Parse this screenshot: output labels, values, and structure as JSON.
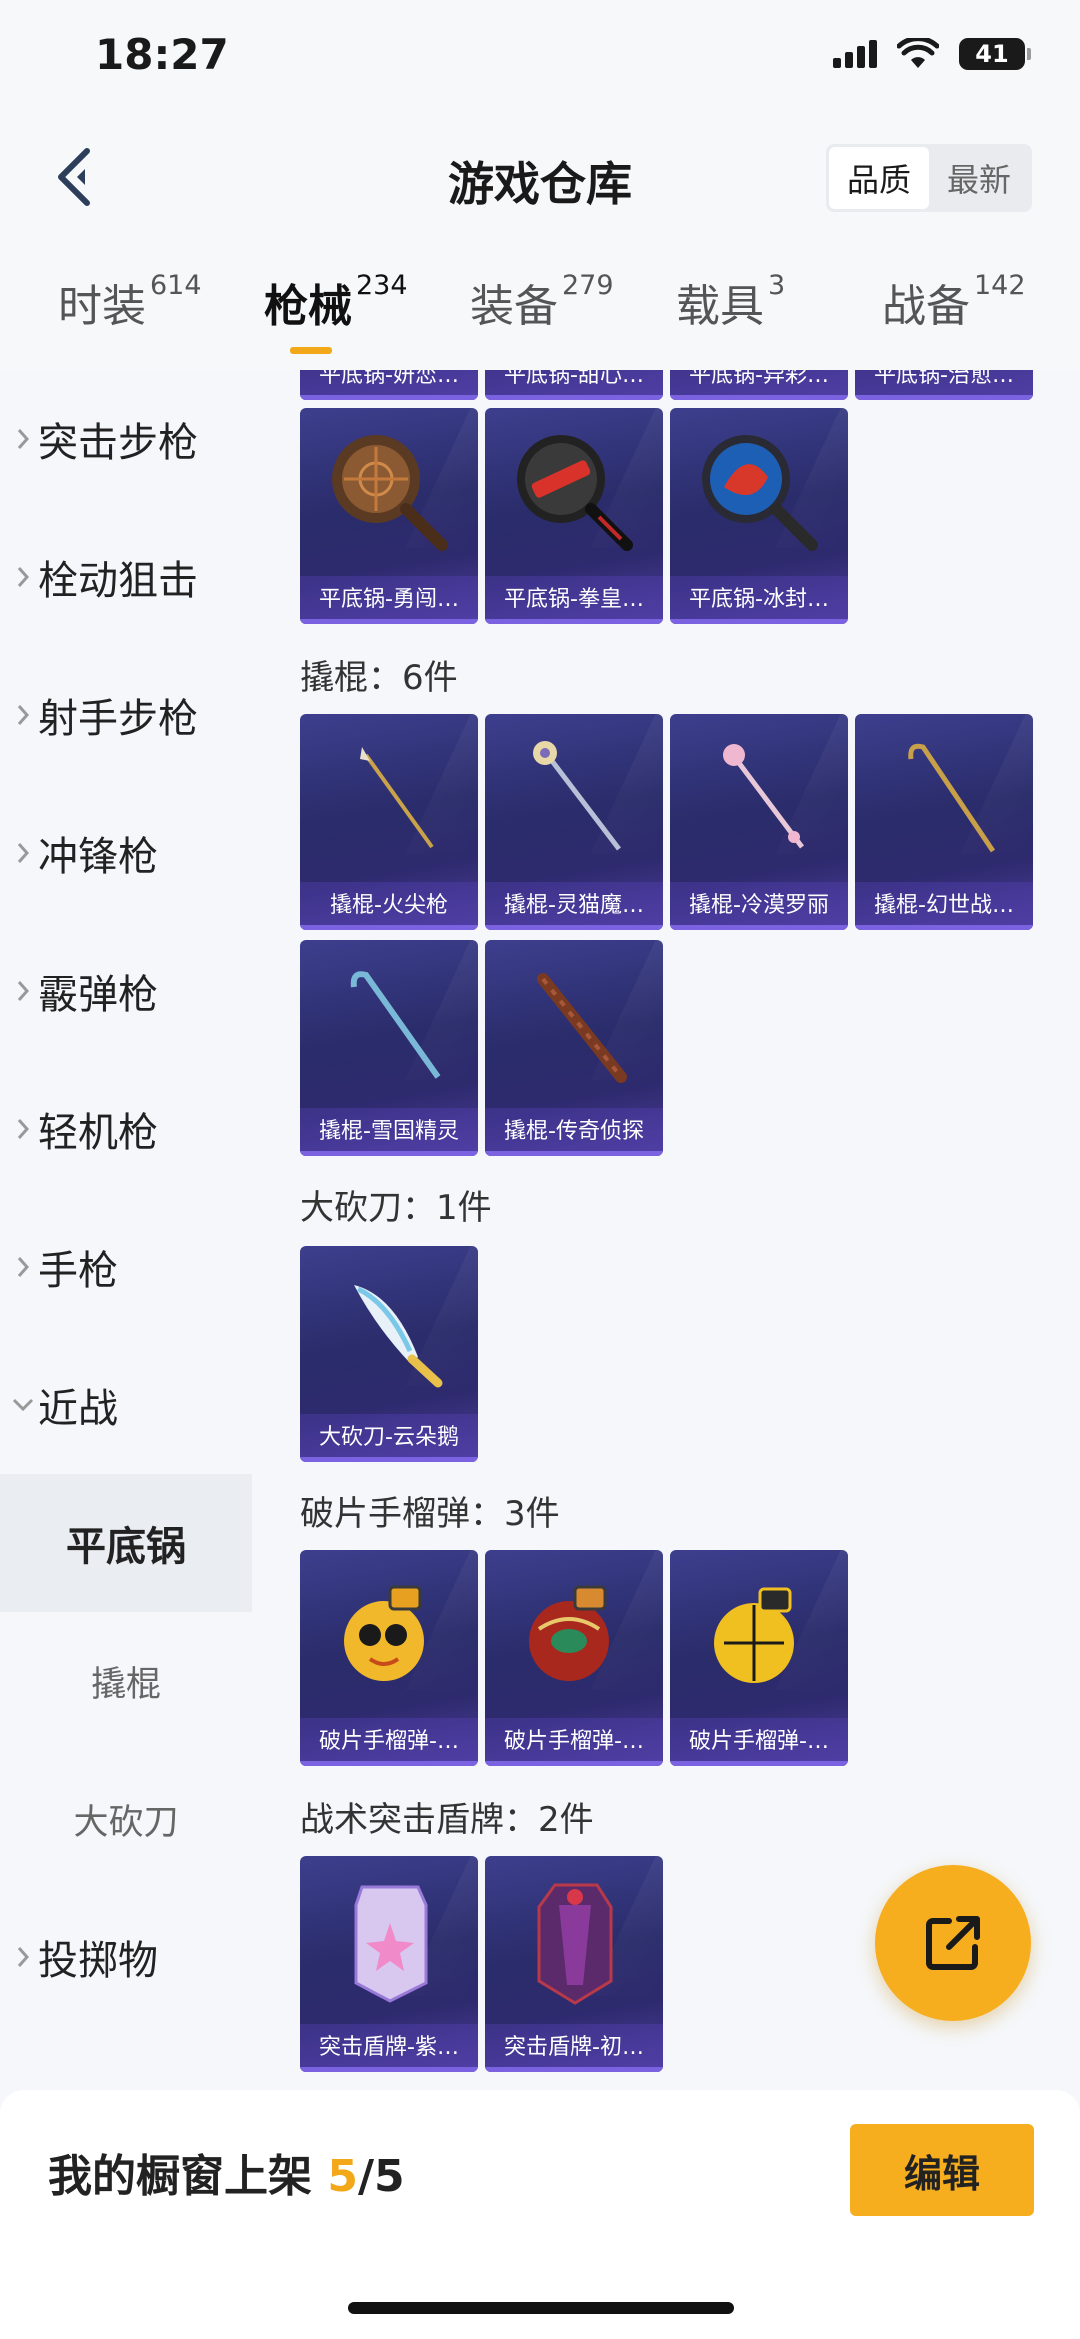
{
  "status": {
    "time": "18:27",
    "battery": "41"
  },
  "header": {
    "title": "游戏仓库",
    "sort_quality": "品质",
    "sort_newest": "最新"
  },
  "tabs": [
    {
      "label": "时装",
      "count": "614"
    },
    {
      "label": "枪械",
      "count": "234"
    },
    {
      "label": "装备",
      "count": "279"
    },
    {
      "label": "载具",
      "count": "3"
    },
    {
      "label": "战备",
      "count": "142"
    }
  ],
  "sidebar": {
    "items": [
      {
        "label": "突击步枪"
      },
      {
        "label": "栓动狙击"
      },
      {
        "label": "射手步枪"
      },
      {
        "label": "冲锋枪"
      },
      {
        "label": "霰弹枪"
      },
      {
        "label": "轻机枪"
      },
      {
        "label": "手枪"
      },
      {
        "label": "近战"
      },
      {
        "label": "平底锅"
      },
      {
        "label": "撬棍"
      },
      {
        "label": "大砍刀"
      },
      {
        "label": "投掷物"
      }
    ]
  },
  "sections": [
    {
      "title": "",
      "items": [
        {
          "label": "平底锅-妍恋…"
        },
        {
          "label": "平底锅-甜心…"
        },
        {
          "label": "平底锅-异彩…"
        },
        {
          "label": "平底锅-治愈…"
        },
        {
          "label": "平底锅-勇闯…"
        },
        {
          "label": "平底锅-拳皇…"
        },
        {
          "label": "平底锅-冰封…"
        }
      ]
    },
    {
      "title": "撬棍：6件",
      "items": [
        {
          "label": "撬棍-火尖枪"
        },
        {
          "label": "撬棍-灵猫魔…"
        },
        {
          "label": "撬棍-冷漠罗丽"
        },
        {
          "label": "撬棍-幻世战…"
        },
        {
          "label": "撬棍-雪国精灵"
        },
        {
          "label": "撬棍-传奇侦探"
        }
      ]
    },
    {
      "title": "大砍刀：1件",
      "items": [
        {
          "label": "大砍刀-云朵鹅"
        }
      ]
    },
    {
      "title": "破片手榴弹：3件",
      "items": [
        {
          "label": "破片手榴弹-…"
        },
        {
          "label": "破片手榴弹-…"
        },
        {
          "label": "破片手榴弹-…"
        }
      ]
    },
    {
      "title": "战术突击盾牌：2件",
      "items": [
        {
          "label": "突击盾牌-紫…"
        },
        {
          "label": "突击盾牌-初…"
        }
      ]
    }
  ],
  "bottom": {
    "showcase_label": "我的橱窗上架",
    "showcase_current": "5",
    "showcase_total": "/5",
    "edit_label": "编辑"
  },
  "colors": {
    "accent": "#f6ae1e",
    "card_bg": "#2e2d72"
  }
}
